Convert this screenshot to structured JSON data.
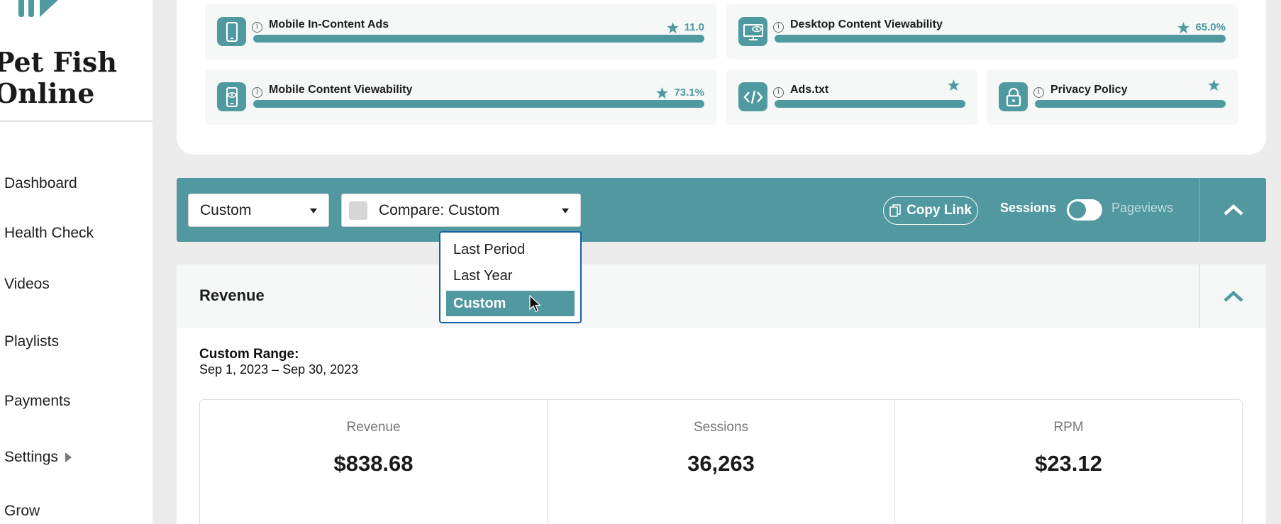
{
  "sidebar": {
    "site_name_line1": "Pet Fish",
    "site_name_line2": "Online",
    "nav": [
      {
        "label": "Dashboard"
      },
      {
        "label": "Health Check"
      },
      {
        "label": "Videos"
      },
      {
        "label": "Playlists"
      },
      {
        "label": "Payments"
      },
      {
        "label": "Settings"
      },
      {
        "label": "Grow"
      }
    ]
  },
  "score_tiles": [
    {
      "title": "Mobile In-Content Ads",
      "score": "11.0",
      "icon": "mobile-phone-icon",
      "fill": 1.0
    },
    {
      "title": "Desktop Content Viewability",
      "score": "65.0%",
      "icon": "desktop-eye-icon",
      "fill": 1.0
    },
    {
      "title": "Mobile Content Viewability",
      "score": "73.1%",
      "icon": "mobile-eye-icon",
      "fill": 1.0
    },
    {
      "title": "Ads.txt",
      "score": "",
      "icon": "code-icon",
      "fill": 1.0
    },
    {
      "title": "Privacy Policy",
      "score": "",
      "icon": "lock-icon",
      "fill": 1.0
    }
  ],
  "filter_bar": {
    "range_select": "Custom",
    "compare_select": "Compare: Custom",
    "copy_link": "Copy Link",
    "sessions_label": "Sessions",
    "pageviews_label": "Pageviews"
  },
  "compare_dropdown": {
    "options": [
      "Last Period",
      "Last Year",
      "Custom"
    ],
    "selected": "Custom"
  },
  "revenue": {
    "title": "Revenue",
    "range_label": "Custom Range:",
    "range_value": "Sep 1, 2023 – Sep 30, 2023",
    "metrics": [
      {
        "label": "Revenue",
        "value": "$838.68"
      },
      {
        "label": "Sessions",
        "value": "36,263"
      },
      {
        "label": "RPM",
        "value": "$23.12"
      }
    ]
  },
  "colors": {
    "accent": "#5298a0",
    "icon_bg": "#4e9aa0",
    "dropdown_border": "#1a5fa5"
  }
}
